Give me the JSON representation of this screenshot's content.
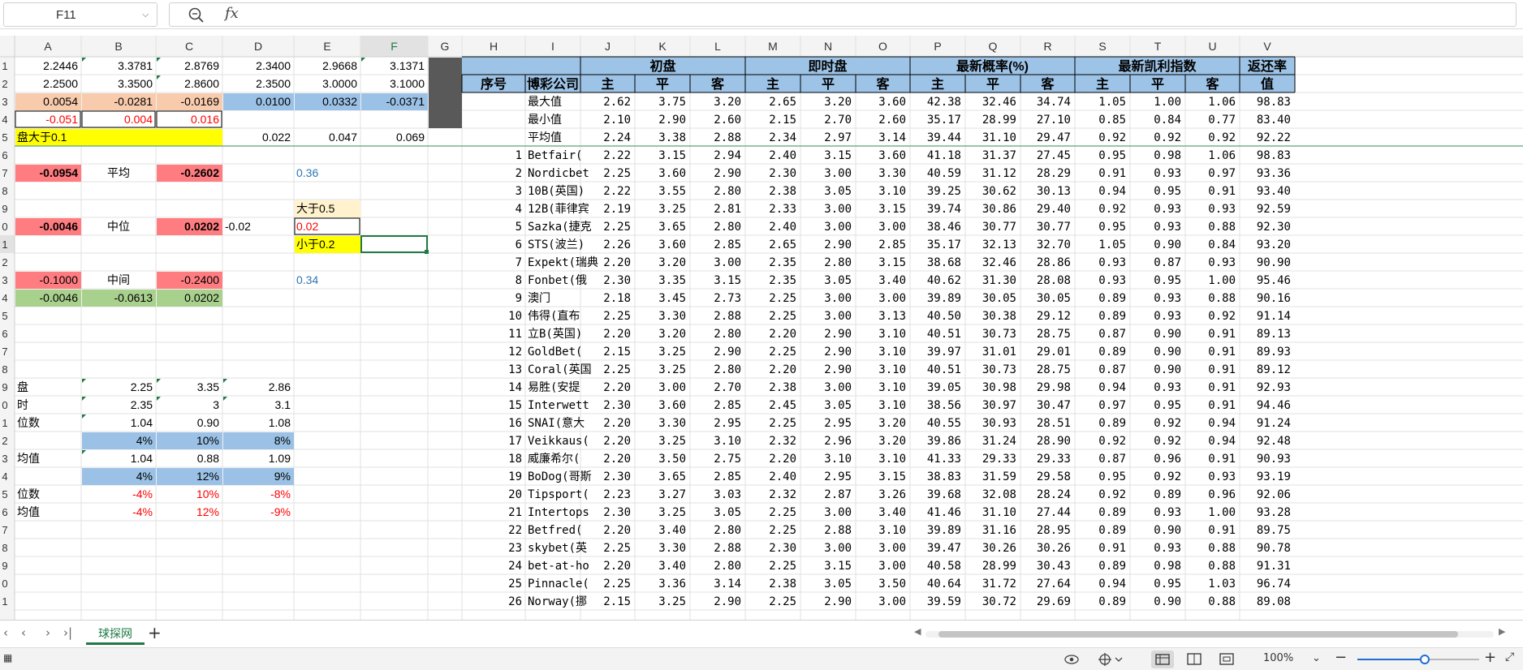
{
  "formula_bar": {
    "cell_ref": "F11",
    "fx": "fx",
    "content": ""
  },
  "sheet_tabs": [
    {
      "label": "球探网",
      "active": true
    }
  ],
  "status_bar": {
    "zoom": "100%",
    "zoom_fraction": 0.55
  },
  "colors": {
    "header_blue": "#9dc3e6",
    "header_dark": "#595959",
    "salmon": "#f8cbad",
    "blue_fill": "#9bc2e6",
    "yellow": "#ffff00",
    "light_yellow": "#fff2cc",
    "red_fill": "#ff7c80",
    "green_fill": "#a9d18e",
    "red_text": "#ff0000",
    "blue_text": "#2e75b6",
    "accent_green": "#1e7a45"
  },
  "columns": [
    "A",
    "B",
    "C",
    "D",
    "E",
    "F",
    "G",
    "H",
    "I",
    "J",
    "K",
    "L",
    "M",
    "N",
    "O",
    "P",
    "Q",
    "R",
    "S",
    "T",
    "U",
    "V"
  ],
  "row_numbers": [
    "1",
    "2",
    "3",
    "4",
    "5",
    "6",
    "7",
    "8",
    "9",
    "0",
    "1",
    "2",
    "3",
    "4",
    "5",
    "6",
    "7",
    "8",
    "9",
    "0",
    "1",
    "2",
    "3",
    "4",
    "5",
    "6",
    "7",
    "8",
    "9",
    "0",
    "1"
  ],
  "left_cells": [
    {
      "r": 1,
      "c": "A",
      "t": "2.2446"
    },
    {
      "r": 1,
      "c": "B",
      "t": "3.3781"
    },
    {
      "r": 1,
      "c": "C",
      "t": "2.8769"
    },
    {
      "r": 1,
      "c": "D",
      "t": "2.3400"
    },
    {
      "r": 1,
      "c": "E",
      "t": "2.9668"
    },
    {
      "r": 1,
      "c": "F",
      "t": "3.1371"
    },
    {
      "r": 2,
      "c": "A",
      "t": "2.2500"
    },
    {
      "r": 2,
      "c": "B",
      "t": "3.3500"
    },
    {
      "r": 2,
      "c": "C",
      "t": "2.8600"
    },
    {
      "r": 2,
      "c": "D",
      "t": "2.3500"
    },
    {
      "r": 2,
      "c": "E",
      "t": "3.0000"
    },
    {
      "r": 2,
      "c": "F",
      "t": "3.1000"
    },
    {
      "r": 3,
      "c": "A",
      "t": "0.0054",
      "fill": "salmon"
    },
    {
      "r": 3,
      "c": "B",
      "t": "-0.0281",
      "fill": "salmon"
    },
    {
      "r": 3,
      "c": "C",
      "t": "-0.0169",
      "fill": "salmon"
    },
    {
      "r": 3,
      "c": "D",
      "t": "0.0100",
      "fill": "blue_fill"
    },
    {
      "r": 3,
      "c": "E",
      "t": "0.0332",
      "fill": "blue_fill"
    },
    {
      "r": 3,
      "c": "F",
      "t": "-0.0371",
      "fill": "blue_fill"
    },
    {
      "r": 4,
      "c": "A",
      "t": "-0.051",
      "color": "red_text",
      "box": true
    },
    {
      "r": 4,
      "c": "B",
      "t": "0.004",
      "color": "red_text",
      "box": true
    },
    {
      "r": 4,
      "c": "C",
      "t": "0.016",
      "color": "red_text",
      "box": true
    },
    {
      "r": 5,
      "c": "A",
      "t": "盘大于0.1",
      "fill": "yellow",
      "span": 3,
      "align": "left"
    },
    {
      "r": 5,
      "c": "D",
      "t": "0.022"
    },
    {
      "r": 5,
      "c": "E",
      "t": "0.047"
    },
    {
      "r": 5,
      "c": "F",
      "t": "0.069"
    },
    {
      "r": 7,
      "c": "A",
      "t": "-0.0954",
      "fill": "red_fill",
      "bold": true
    },
    {
      "r": 7,
      "c": "B",
      "t": "平均",
      "align": "center"
    },
    {
      "r": 7,
      "c": "C",
      "t": "-0.2602",
      "fill": "red_fill",
      "bold": true
    },
    {
      "r": 7,
      "c": "E",
      "t": "0.36",
      "color": "blue_text",
      "align": "left"
    },
    {
      "r": 9,
      "c": "E",
      "t": "大于0.5",
      "fill": "light_yellow",
      "align": "left"
    },
    {
      "r": 10,
      "c": "A",
      "t": "-0.0046",
      "fill": "red_fill",
      "bold": true
    },
    {
      "r": 10,
      "c": "B",
      "t": "中位",
      "align": "center"
    },
    {
      "r": 10,
      "c": "C",
      "t": "0.0202",
      "fill": "red_fill",
      "bold": true
    },
    {
      "r": 10,
      "c": "D",
      "t": "-0.02",
      "align": "left"
    },
    {
      "r": 10,
      "c": "E",
      "t": "0.02",
      "color": "red_text",
      "box": true,
      "align": "left"
    },
    {
      "r": 11,
      "c": "E",
      "t": "小于0.2",
      "fill": "yellow",
      "align": "left"
    },
    {
      "r": 13,
      "c": "A",
      "t": "-0.1000",
      "fill": "red_fill"
    },
    {
      "r": 13,
      "c": "B",
      "t": "中间",
      "align": "center"
    },
    {
      "r": 13,
      "c": "C",
      "t": "-0.2400",
      "fill": "red_fill"
    },
    {
      "r": 13,
      "c": "E",
      "t": "0.34",
      "color": "blue_text",
      "align": "left"
    },
    {
      "r": 14,
      "c": "A",
      "t": "-0.0046",
      "fill": "green_fill"
    },
    {
      "r": 14,
      "c": "B",
      "t": "-0.0613",
      "fill": "green_fill"
    },
    {
      "r": 14,
      "c": "C",
      "t": "0.0202",
      "fill": "green_fill"
    },
    {
      "r": 19,
      "c": "A",
      "t": "盘",
      "align": "left"
    },
    {
      "r": 19,
      "c": "B",
      "t": "2.25"
    },
    {
      "r": 19,
      "c": "C",
      "t": "3.35"
    },
    {
      "r": 19,
      "c": "D",
      "t": "2.86"
    },
    {
      "r": 20,
      "c": "A",
      "t": "时",
      "align": "left"
    },
    {
      "r": 20,
      "c": "B",
      "t": "2.35"
    },
    {
      "r": 20,
      "c": "C",
      "t": "3"
    },
    {
      "r": 20,
      "c": "D",
      "t": "3.1"
    },
    {
      "r": 21,
      "c": "A",
      "t": "位数",
      "align": "left"
    },
    {
      "r": 21,
      "c": "B",
      "t": "1.04"
    },
    {
      "r": 21,
      "c": "C",
      "t": "0.90"
    },
    {
      "r": 21,
      "c": "D",
      "t": "1.08"
    },
    {
      "r": 22,
      "c": "B",
      "t": "4%",
      "fill": "blue_fill"
    },
    {
      "r": 22,
      "c": "C",
      "t": "10%",
      "fill": "blue_fill"
    },
    {
      "r": 22,
      "c": "D",
      "t": "8%",
      "fill": "blue_fill"
    },
    {
      "r": 23,
      "c": "A",
      "t": "均值",
      "align": "left"
    },
    {
      "r": 23,
      "c": "B",
      "t": "1.04"
    },
    {
      "r": 23,
      "c": "C",
      "t": "0.88"
    },
    {
      "r": 23,
      "c": "D",
      "t": "1.09"
    },
    {
      "r": 24,
      "c": "B",
      "t": "4%",
      "fill": "blue_fill"
    },
    {
      "r": 24,
      "c": "C",
      "t": "12%",
      "fill": "blue_fill"
    },
    {
      "r": 24,
      "c": "D",
      "t": "9%",
      "fill": "blue_fill"
    },
    {
      "r": 25,
      "c": "A",
      "t": "位数",
      "align": "left"
    },
    {
      "r": 25,
      "c": "B",
      "t": "-4%",
      "color": "red_text"
    },
    {
      "r": 25,
      "c": "C",
      "t": "10%",
      "color": "red_text"
    },
    {
      "r": 25,
      "c": "D",
      "t": "-8%",
      "color": "red_text"
    },
    {
      "r": 26,
      "c": "A",
      "t": "均值",
      "align": "left"
    },
    {
      "r": 26,
      "c": "B",
      "t": "-4%",
      "color": "red_text"
    },
    {
      "r": 26,
      "c": "C",
      "t": "12%",
      "color": "red_text"
    },
    {
      "r": 26,
      "c": "D",
      "t": "-9%",
      "color": "red_text"
    }
  ],
  "odds_table": {
    "group_headers": [
      {
        "label": "初盘",
        "from": "J",
        "to": "L"
      },
      {
        "label": "即时盘",
        "from": "M",
        "to": "O"
      },
      {
        "label": "最新概率(%)",
        "from": "P",
        "to": "R"
      },
      {
        "label": "最新凯利指数",
        "from": "S",
        "to": "U"
      },
      {
        "label": "返还率",
        "from": "V",
        "to": "V"
      }
    ],
    "sub_headers": {
      "H": "序号",
      "I": "博彩公司",
      "J": "主",
      "K": "平",
      "L": "客",
      "M": "主",
      "N": "平",
      "O": "客",
      "P": "主",
      "Q": "平",
      "R": "客",
      "S": "主",
      "T": "平",
      "U": "客",
      "V": "值"
    },
    "summary_rows": [
      {
        "label": "最大值",
        "vals": [
          "2.62",
          "3.75",
          "3.20",
          "2.65",
          "3.20",
          "3.60",
          "42.38",
          "32.46",
          "34.74",
          "1.05",
          "1.00",
          "1.06",
          "98.83"
        ]
      },
      {
        "label": "最小值",
        "vals": [
          "2.10",
          "2.90",
          "2.60",
          "2.15",
          "2.70",
          "2.60",
          "35.17",
          "28.99",
          "27.10",
          "0.85",
          "0.84",
          "0.77",
          "83.40"
        ]
      },
      {
        "label": "平均值",
        "vals": [
          "2.24",
          "3.38",
          "2.88",
          "2.34",
          "2.97",
          "3.14",
          "39.44",
          "31.10",
          "29.47",
          "0.92",
          "0.92",
          "0.92",
          "92.22"
        ]
      }
    ],
    "rows": [
      {
        "n": "1",
        "co": "Betfair(",
        "vals": [
          "2.22",
          "3.15",
          "2.94",
          "2.40",
          "3.15",
          "3.60",
          "41.18",
          "31.37",
          "27.45",
          "0.95",
          "0.98",
          "1.06",
          "98.83"
        ]
      },
      {
        "n": "2",
        "co": "Nordicbet",
        "vals": [
          "2.25",
          "3.60",
          "2.90",
          "2.30",
          "3.00",
          "3.30",
          "40.59",
          "31.12",
          "28.29",
          "0.91",
          "0.93",
          "0.97",
          "93.36"
        ]
      },
      {
        "n": "3",
        "co": "10B(英国)",
        "vals": [
          "2.22",
          "3.55",
          "2.80",
          "2.38",
          "3.05",
          "3.10",
          "39.25",
          "30.62",
          "30.13",
          "0.94",
          "0.95",
          "0.91",
          "93.40"
        ]
      },
      {
        "n": "4",
        "co": "12B(菲律宾",
        "vals": [
          "2.19",
          "3.25",
          "2.81",
          "2.33",
          "3.00",
          "3.15",
          "39.74",
          "30.86",
          "29.40",
          "0.92",
          "0.93",
          "0.93",
          "92.59"
        ]
      },
      {
        "n": "5",
        "co": "Sazka(捷克",
        "vals": [
          "2.25",
          "3.65",
          "2.80",
          "2.40",
          "3.00",
          "3.00",
          "38.46",
          "30.77",
          "30.77",
          "0.95",
          "0.93",
          "0.88",
          "92.30"
        ]
      },
      {
        "n": "6",
        "co": "STS(波兰)",
        "vals": [
          "2.26",
          "3.60",
          "2.85",
          "2.65",
          "2.90",
          "2.85",
          "35.17",
          "32.13",
          "32.70",
          "1.05",
          "0.90",
          "0.84",
          "93.20"
        ]
      },
      {
        "n": "7",
        "co": "Expekt(瑞典",
        "vals": [
          "2.20",
          "3.20",
          "3.00",
          "2.35",
          "2.80",
          "3.15",
          "38.68",
          "32.46",
          "28.86",
          "0.93",
          "0.87",
          "0.93",
          "90.90"
        ]
      },
      {
        "n": "8",
        "co": "Fonbet(俄",
        "vals": [
          "2.30",
          "3.35",
          "3.15",
          "2.35",
          "3.05",
          "3.40",
          "40.62",
          "31.30",
          "28.08",
          "0.93",
          "0.95",
          "1.00",
          "95.46"
        ]
      },
      {
        "n": "9",
        "co": "澳门",
        "vals": [
          "2.18",
          "3.45",
          "2.73",
          "2.25",
          "3.00",
          "3.00",
          "39.89",
          "30.05",
          "30.05",
          "0.89",
          "0.93",
          "0.88",
          "90.16"
        ]
      },
      {
        "n": "10",
        "co": "伟得(直布",
        "vals": [
          "2.25",
          "3.30",
          "2.88",
          "2.25",
          "3.00",
          "3.13",
          "40.50",
          "30.38",
          "29.12",
          "0.89",
          "0.93",
          "0.92",
          "91.14"
        ]
      },
      {
        "n": "11",
        "co": "立B(英国)",
        "vals": [
          "2.20",
          "3.20",
          "2.80",
          "2.20",
          "2.90",
          "3.10",
          "40.51",
          "30.73",
          "28.75",
          "0.87",
          "0.90",
          "0.91",
          "89.13"
        ]
      },
      {
        "n": "12",
        "co": "GoldBet(",
        "vals": [
          "2.15",
          "3.25",
          "2.90",
          "2.25",
          "2.90",
          "3.10",
          "39.97",
          "31.01",
          "29.01",
          "0.89",
          "0.90",
          "0.91",
          "89.93"
        ]
      },
      {
        "n": "13",
        "co": "Coral(英国",
        "vals": [
          "2.25",
          "3.25",
          "2.80",
          "2.20",
          "2.90",
          "3.10",
          "40.51",
          "30.73",
          "28.75",
          "0.87",
          "0.90",
          "0.91",
          "89.12"
        ]
      },
      {
        "n": "14",
        "co": "易胜(安提",
        "vals": [
          "2.20",
          "3.00",
          "2.70",
          "2.38",
          "3.00",
          "3.10",
          "39.05",
          "30.98",
          "29.98",
          "0.94",
          "0.93",
          "0.91",
          "92.93"
        ]
      },
      {
        "n": "15",
        "co": "Interwett",
        "vals": [
          "2.30",
          "3.60",
          "2.85",
          "2.45",
          "3.05",
          "3.10",
          "38.56",
          "30.97",
          "30.47",
          "0.97",
          "0.95",
          "0.91",
          "94.46"
        ]
      },
      {
        "n": "16",
        "co": "SNAI(意大",
        "vals": [
          "2.20",
          "3.30",
          "2.95",
          "2.25",
          "2.95",
          "3.20",
          "40.55",
          "30.93",
          "28.51",
          "0.89",
          "0.92",
          "0.94",
          "91.24"
        ]
      },
      {
        "n": "17",
        "co": "Veikkaus(",
        "vals": [
          "2.20",
          "3.25",
          "3.10",
          "2.32",
          "2.96",
          "3.20",
          "39.86",
          "31.24",
          "28.90",
          "0.92",
          "0.92",
          "0.94",
          "92.48"
        ]
      },
      {
        "n": "18",
        "co": "威廉希尔(",
        "vals": [
          "2.20",
          "3.50",
          "2.75",
          "2.20",
          "3.10",
          "3.10",
          "41.33",
          "29.33",
          "29.33",
          "0.87",
          "0.96",
          "0.91",
          "90.93"
        ]
      },
      {
        "n": "19",
        "co": "BoDog(哥斯",
        "vals": [
          "2.30",
          "3.65",
          "2.85",
          "2.40",
          "2.95",
          "3.15",
          "38.83",
          "31.59",
          "29.58",
          "0.95",
          "0.92",
          "0.93",
          "93.19"
        ]
      },
      {
        "n": "20",
        "co": "Tipsport(",
        "vals": [
          "2.23",
          "3.27",
          "3.03",
          "2.32",
          "2.87",
          "3.26",
          "39.68",
          "32.08",
          "28.24",
          "0.92",
          "0.89",
          "0.96",
          "92.06"
        ]
      },
      {
        "n": "21",
        "co": "Intertops",
        "vals": [
          "2.30",
          "3.25",
          "3.05",
          "2.25",
          "3.00",
          "3.40",
          "41.46",
          "31.10",
          "27.44",
          "0.89",
          "0.93",
          "1.00",
          "93.28"
        ]
      },
      {
        "n": "22",
        "co": "Betfred(",
        "vals": [
          "2.20",
          "3.40",
          "2.80",
          "2.25",
          "2.88",
          "3.10",
          "39.89",
          "31.16",
          "28.95",
          "0.89",
          "0.90",
          "0.91",
          "89.75"
        ]
      },
      {
        "n": "23",
        "co": "skybet(英",
        "vals": [
          "2.25",
          "3.30",
          "2.88",
          "2.30",
          "3.00",
          "3.00",
          "39.47",
          "30.26",
          "30.26",
          "0.91",
          "0.93",
          "0.88",
          "90.78"
        ]
      },
      {
        "n": "24",
        "co": "bet-at-ho",
        "vals": [
          "2.20",
          "3.40",
          "2.80",
          "2.25",
          "3.15",
          "3.00",
          "40.58",
          "28.99",
          "30.43",
          "0.89",
          "0.98",
          "0.88",
          "91.31"
        ]
      },
      {
        "n": "25",
        "co": "Pinnacle(",
        "vals": [
          "2.25",
          "3.36",
          "3.14",
          "2.38",
          "3.05",
          "3.50",
          "40.64",
          "31.72",
          "27.64",
          "0.94",
          "0.95",
          "1.03",
          "96.74"
        ]
      },
      {
        "n": "26",
        "co": "Norway(挪",
        "vals": [
          "2.15",
          "3.25",
          "2.90",
          "2.25",
          "2.90",
          "3.00",
          "39.59",
          "30.72",
          "29.69",
          "0.89",
          "0.90",
          "0.88",
          "89.08"
        ]
      }
    ]
  }
}
